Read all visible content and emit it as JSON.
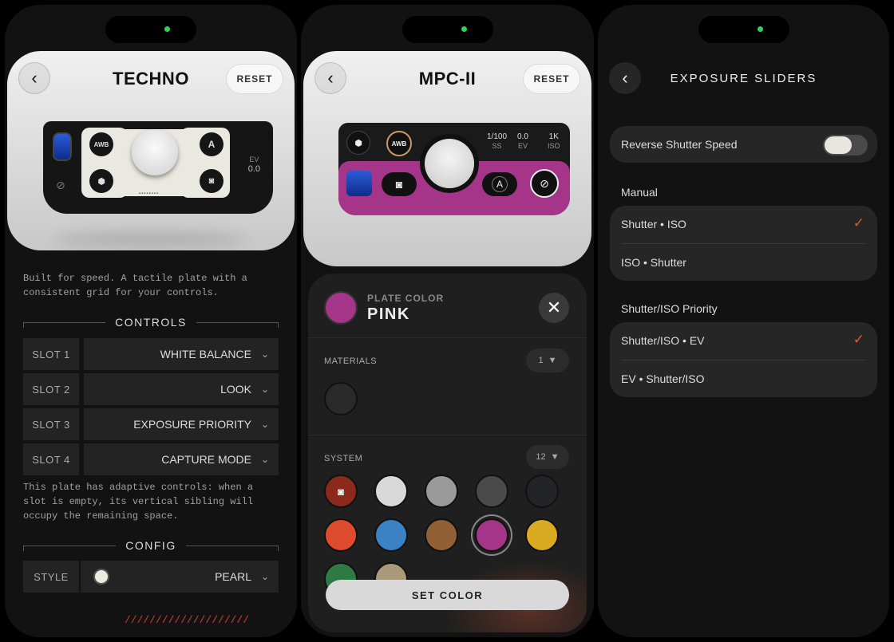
{
  "techno": {
    "title": "TECHNO",
    "reset_label": "RESET",
    "device": {
      "awb": "AWB",
      "a": "A",
      "ev_label": "EV",
      "ev_value": "0.0"
    },
    "description": "Built for speed. A tactile plate with a consistent grid for your controls.",
    "controls_title": "CONTROLS",
    "slots": [
      {
        "label": "SLOT 1",
        "value": "WHITE BALANCE"
      },
      {
        "label": "SLOT 2",
        "value": "LOOK"
      },
      {
        "label": "SLOT 3",
        "value": "EXPOSURE PRIORITY"
      },
      {
        "label": "SLOT 4",
        "value": "CAPTURE MODE"
      }
    ],
    "adaptive_note": "This plate has adaptive controls: when a slot is empty, its vertical sibling will occupy the remaining space.",
    "config_title": "CONFIG",
    "style": {
      "label": "STYLE",
      "value": "PEARL"
    },
    "hatch": "////////////////////"
  },
  "mpc": {
    "title": "MPC-II",
    "reset_label": "RESET",
    "device": {
      "awb": "AWB",
      "a": "A",
      "shutter": "1/100",
      "ev": "0.0",
      "iso": "1K",
      "ss_label": "SS",
      "ev_label": "EV",
      "iso_label": "ISO"
    },
    "sheet": {
      "plate_color_label": "PLATE COLOR",
      "plate_color_value": "PINK",
      "materials_label": "MATERIALS",
      "materials_count": "1",
      "system_label": "SYSTEM",
      "system_count": "12",
      "set_color_label": "SET COLOR"
    },
    "colors": {
      "materials": [
        "#2a2a2a"
      ],
      "system": [
        "#8b2a1c",
        "#d9d9d9",
        "#9a9a9a",
        "#4a4a4a",
        "#222428",
        "#de4a2c",
        "#3a82c4",
        "#936036",
        "#a43589",
        "#d8ab22",
        "#2e7a44",
        "#a89a7a"
      ]
    }
  },
  "exposure": {
    "title": "EXPOSURE SLIDERS",
    "reverse_label": "Reverse Shutter Speed",
    "manual_title": "Manual",
    "manual_options": [
      "Shutter • ISO",
      "ISO • Shutter"
    ],
    "priority_title": "Shutter/ISO Priority",
    "priority_options": [
      "Shutter/ISO • EV",
      "EV • Shutter/ISO"
    ],
    "check": "✓",
    "accent": "#d65a3b"
  }
}
